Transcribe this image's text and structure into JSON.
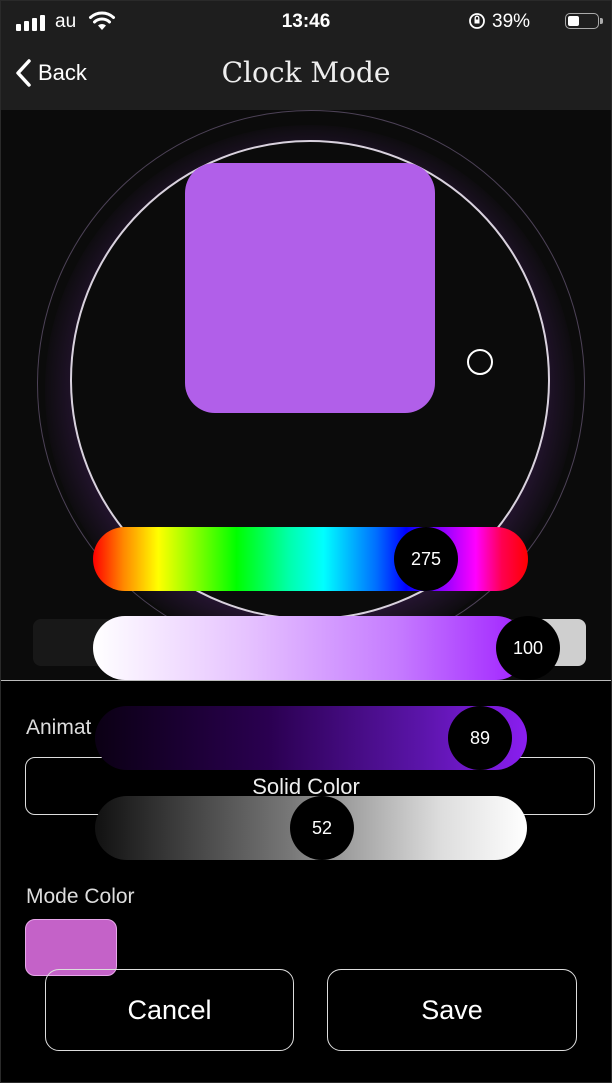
{
  "status_bar": {
    "carrier": "au",
    "time": "13:46",
    "battery_percent_text": "39%",
    "battery_level": 0.39
  },
  "nav": {
    "back_label": "Back",
    "title": "Clock Mode"
  },
  "picker": {
    "selected_color": "#b15fe9",
    "hue_value": "275",
    "saturation_value": "100",
    "brightness_value": "89",
    "white_value": "52"
  },
  "animation": {
    "label": "Animat",
    "selected": "Solid Color"
  },
  "mode_color": {
    "label": "Mode Color",
    "color": "#c462c8"
  },
  "buttons": {
    "cancel": "Cancel",
    "save": "Save"
  }
}
